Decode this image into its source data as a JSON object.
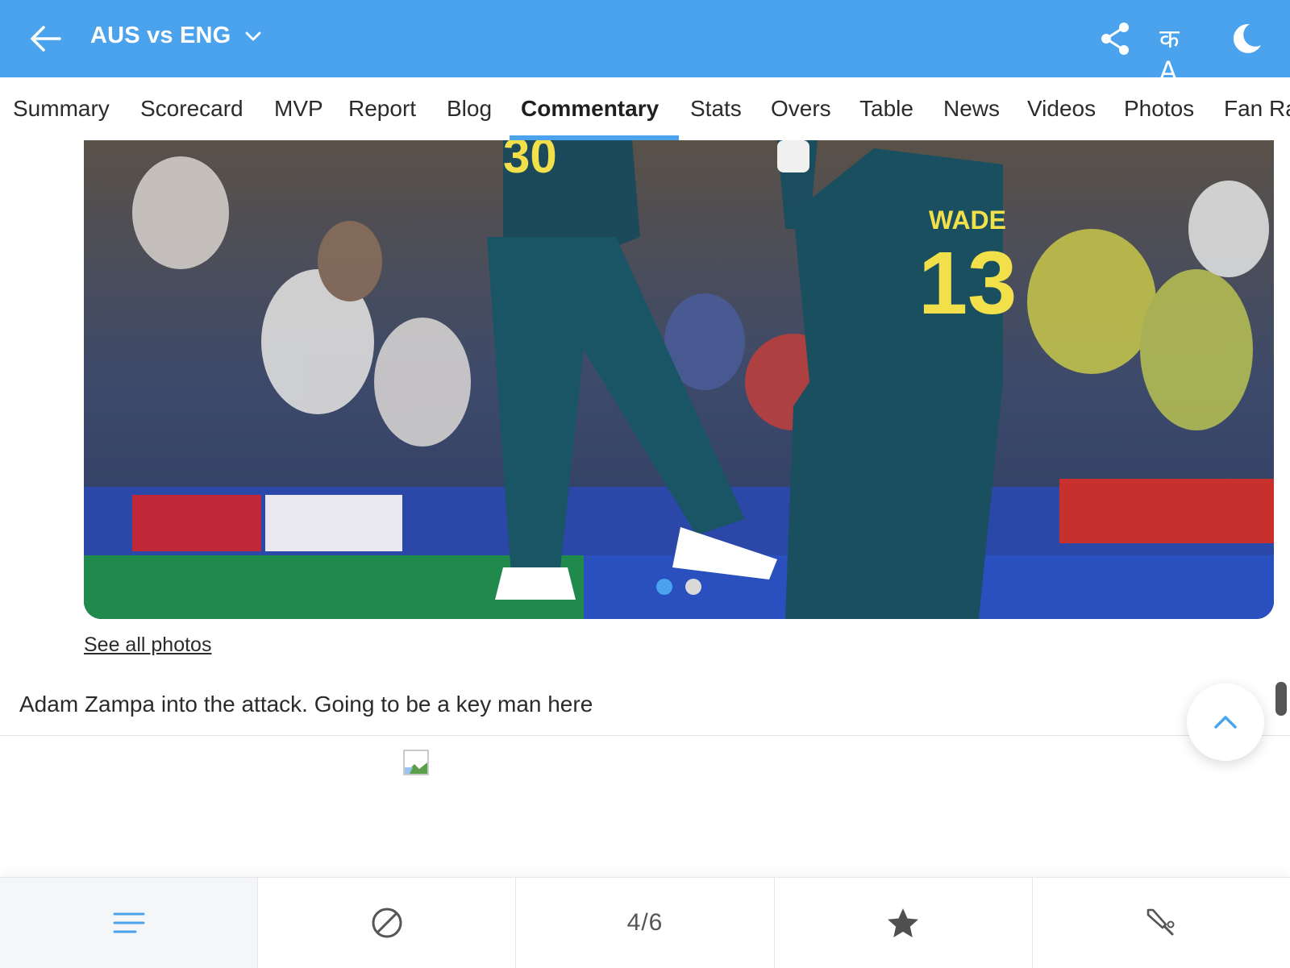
{
  "header": {
    "match_title": "AUS vs ENG",
    "icons": [
      "back-arrow-icon",
      "chevron-down-icon",
      "share-icon",
      "language-icon",
      "dark-mode-icon"
    ],
    "language_glyph": "क A",
    "bg_color": "#4aa3ec"
  },
  "tabs": [
    {
      "label": "Summary",
      "active": false
    },
    {
      "label": "Scorecard",
      "active": false
    },
    {
      "label": "MVP",
      "active": false
    },
    {
      "label": "Report",
      "active": false
    },
    {
      "label": "Blog",
      "active": false
    },
    {
      "label": "Commentary",
      "active": true
    },
    {
      "label": "Stats",
      "active": false
    },
    {
      "label": "Overs",
      "active": false
    },
    {
      "label": "Table",
      "active": false
    },
    {
      "label": "News",
      "active": false
    },
    {
      "label": "Videos",
      "active": false
    },
    {
      "label": "Photos",
      "active": false
    },
    {
      "label": "Fan Ra",
      "active": false
    }
  ],
  "carousel": {
    "jersey_name": "WADE",
    "jersey_number": "13",
    "slide_count": 2,
    "active_slide": 1
  },
  "see_all_photos": "See all photos",
  "commentary_text": "Adam Zampa into the attack. Going to be a key man here",
  "bottom_nav": {
    "icons": [
      "menu-lines-icon",
      "ball-icon",
      "star-icon",
      "cricket-bat-icon"
    ],
    "overs_count": "4/6"
  },
  "accent_color": "#4aa3ec"
}
